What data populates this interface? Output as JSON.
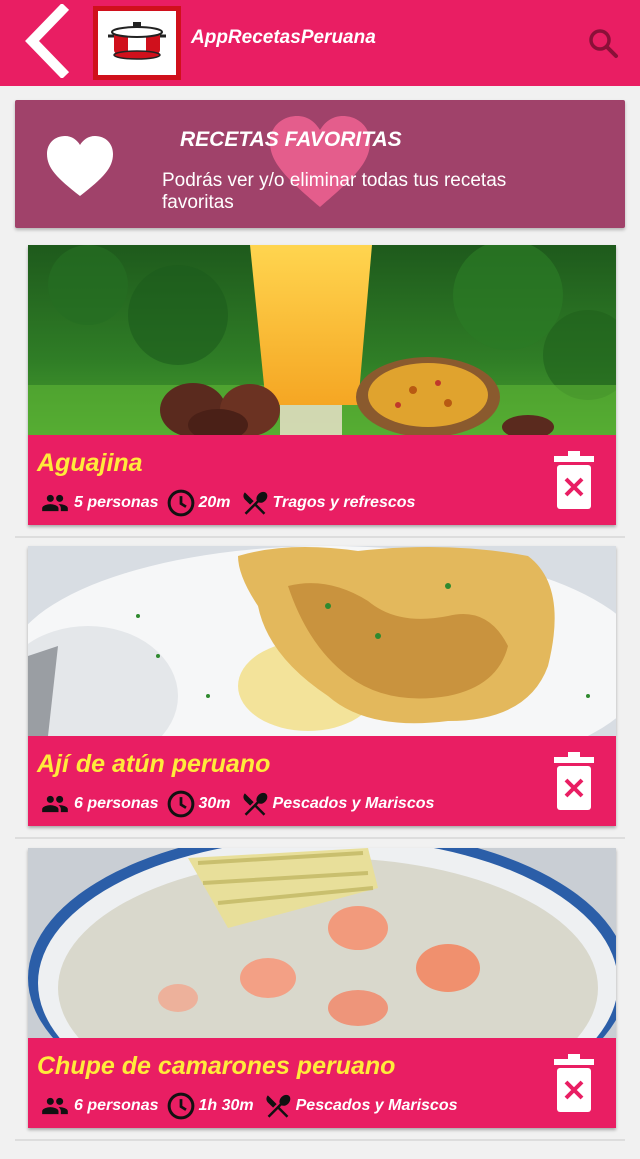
{
  "colors": {
    "primary": "#e91e63",
    "banner": "#a0426a",
    "title_yellow": "#ffeb3b",
    "logo_red": "#d0101c"
  },
  "appbar": {
    "title": "AppRecetasPeruana",
    "back_icon": "chevron-left-icon",
    "search_icon": "search-icon",
    "logo_icon": "cooking-pot-icon"
  },
  "banner": {
    "title": "RECETAS FAVORITAS",
    "description": "Podrás ver y/o eliminar todas tus recetas favoritas",
    "icon": "heart-icon"
  },
  "recipes": [
    {
      "title": "Aguajina",
      "people": "5 personas",
      "time": "20m",
      "category": "Tragos y refrescos"
    },
    {
      "title": "Ají de atún peruano",
      "people": "6 personas",
      "time": "30m",
      "category": "Pescados y Mariscos"
    },
    {
      "title": "Chupe de camarones peruano",
      "people": "6 personas",
      "time": "1h 30m",
      "category": "Pescados y Mariscos"
    }
  ]
}
